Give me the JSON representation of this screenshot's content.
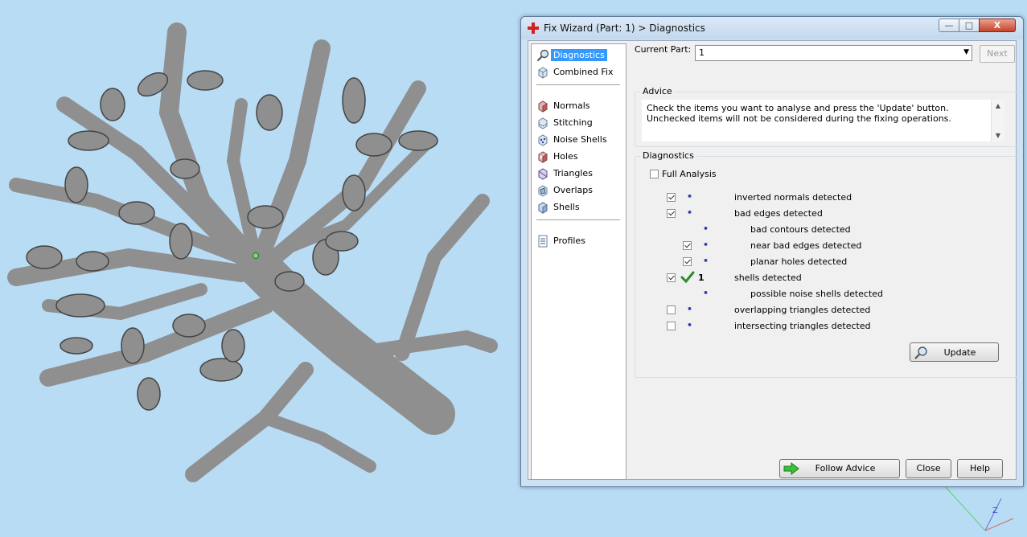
{
  "window": {
    "title": "Fix Wizard (Part: 1) > Diagnostics",
    "minimize_glyph": "—",
    "maximize_glyph": "□",
    "close_glyph": "X"
  },
  "nav": {
    "items": [
      {
        "label": "Diagnostics",
        "icon": "magnifier-icon"
      },
      {
        "label": "Combined Fix",
        "icon": "cube-icon"
      },
      {
        "label": "Normals",
        "icon": "normals-cube-icon"
      },
      {
        "label": "Stitching",
        "icon": "stitching-icon"
      },
      {
        "label": "Noise Shells",
        "icon": "noise-shells-icon"
      },
      {
        "label": "Holes",
        "icon": "holes-icon"
      },
      {
        "label": "Triangles",
        "icon": "triangles-icon"
      },
      {
        "label": "Overlaps",
        "icon": "overlaps-icon"
      },
      {
        "label": "Shells",
        "icon": "shells-icon"
      },
      {
        "label": "Profiles",
        "icon": "document-icon"
      }
    ]
  },
  "current_part": {
    "label": "Current Part:",
    "value": "1"
  },
  "next_label": "Next",
  "advice": {
    "title": "Advice",
    "text": "Check the items you want to analyse and press the 'Update' button. Unchecked items will not be considered during the fixing operations."
  },
  "diagnostics": {
    "title": "Diagnostics",
    "full_analysis": {
      "label": "Full Analysis",
      "checked": false
    },
    "rows": [
      {
        "label": "inverted normals detected",
        "dot": "•",
        "checked": true
      },
      {
        "label": "bad edges detected",
        "dot": "•",
        "checked": true
      },
      {
        "label": "bad contours detected",
        "dot": "•"
      },
      {
        "label": "near bad edges detected",
        "dot": "•",
        "checked": true
      },
      {
        "label": "planar holes detected",
        "dot": "•",
        "checked": true
      },
      {
        "label": "shells detected",
        "count": "1",
        "checked": true,
        "status": "ok-check-icon"
      },
      {
        "label": "possible noise shells detected",
        "dot": "•"
      },
      {
        "label": "overlapping triangles detected",
        "dot": "•",
        "checked": false
      },
      {
        "label": "intersecting triangles detected",
        "dot": "•",
        "checked": false
      }
    ],
    "update_label": "Update"
  },
  "buttons": {
    "follow_advice": "Follow Advice",
    "close": "Close",
    "help": "Help"
  },
  "axis_label": "Z",
  "colors": {
    "viewport_bg": "#b9dcf5",
    "model_gray": "#8f8f8f",
    "selection_blue": "#3399ff",
    "check_green": "#2e8b2e"
  }
}
